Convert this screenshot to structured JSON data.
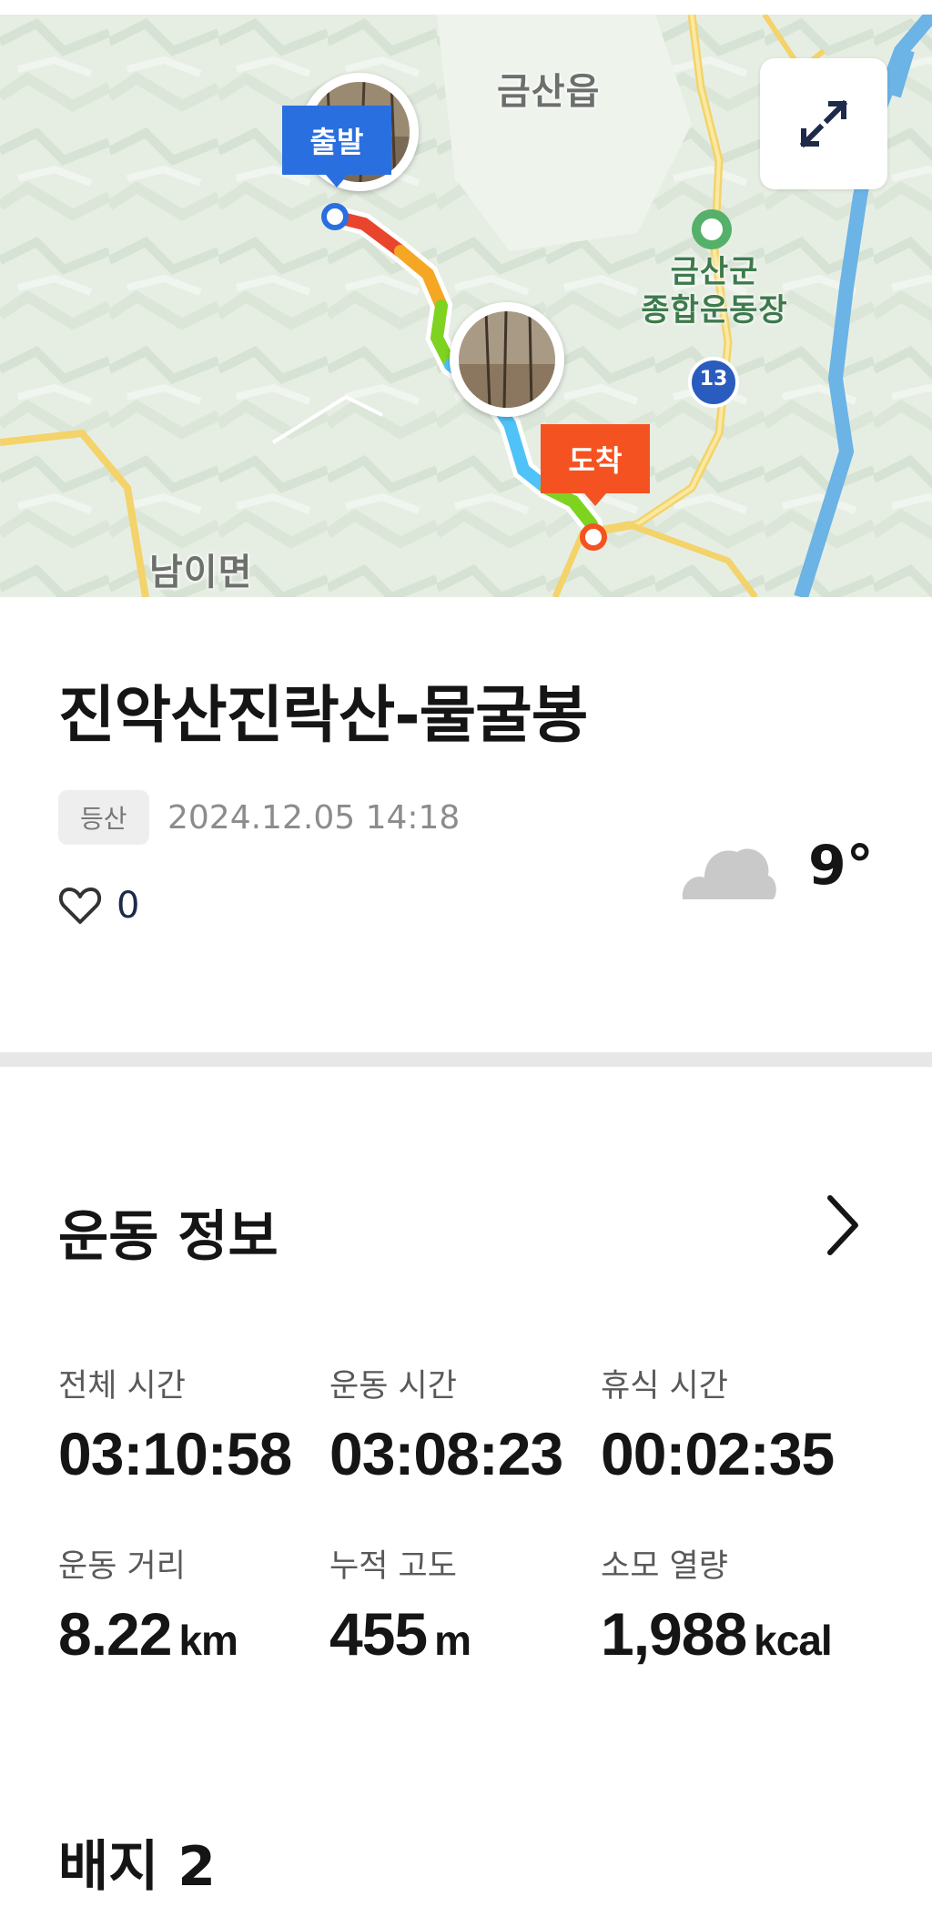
{
  "map": {
    "labels": {
      "town_top": "금산읍",
      "town_bottom": "남이면",
      "landmark_line1": "금산군",
      "landmark_line2": "종합운동장",
      "route_number": "13"
    },
    "start_pin": "출발",
    "end_pin": "도착",
    "expand_icon": "expand-arrows-icon"
  },
  "activity": {
    "title": "진악산진락산-물굴봉",
    "category_tag": "등산",
    "datetime": "2024.12.05 14:18",
    "like_count": "0",
    "weather_icon": "cloud-icon",
    "temperature": "9°"
  },
  "exercise_info": {
    "section_title": "운동 정보",
    "stats": [
      {
        "label": "전체 시간",
        "value": "03:10:58",
        "unit": ""
      },
      {
        "label": "운동 시간",
        "value": "03:08:23",
        "unit": ""
      },
      {
        "label": "휴식 시간",
        "value": "00:02:35",
        "unit": ""
      },
      {
        "label": "운동 거리",
        "value": "8.22",
        "unit": "km"
      },
      {
        "label": "누적 고도",
        "value": "455",
        "unit": "m"
      },
      {
        "label": "소모 열량",
        "value": "1,988",
        "unit": "kcal"
      }
    ]
  },
  "badges": {
    "section_title": "배지 2"
  },
  "colors": {
    "start_pin": "#2a6fe0",
    "end_pin": "#f45321",
    "route_blue": "#4fc3f7",
    "route_green": "#7ed321",
    "route_orange": "#f5a623",
    "route_red": "#e8452c"
  }
}
